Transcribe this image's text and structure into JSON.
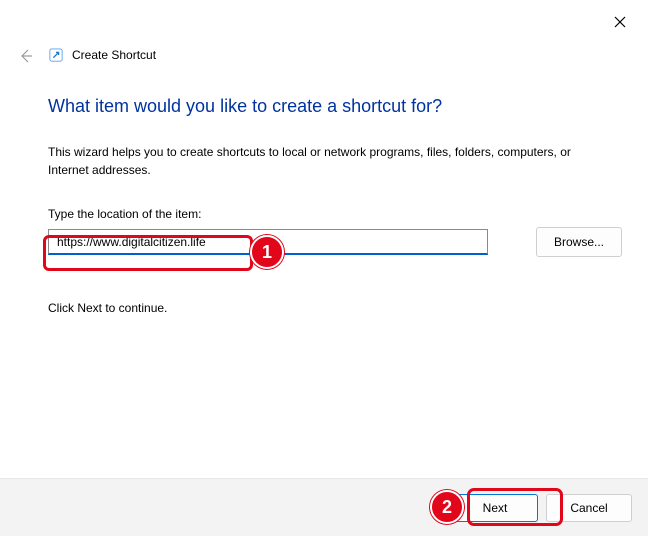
{
  "titlebar": {
    "wizard_name": "Create Shortcut"
  },
  "content": {
    "heading": "What item would you like to create a shortcut for?",
    "description": "This wizard helps you to create shortcuts to local or network programs, files, folders, computers, or Internet addresses.",
    "field_label": "Type the location of the item:",
    "location_value": "https://www.digitalcitizen.life",
    "browse_label": "Browse...",
    "continue_text": "Click Next to continue."
  },
  "footer": {
    "next_label": "Next",
    "cancel_label": "Cancel"
  },
  "annotations": {
    "callout1": "1",
    "callout2": "2"
  }
}
